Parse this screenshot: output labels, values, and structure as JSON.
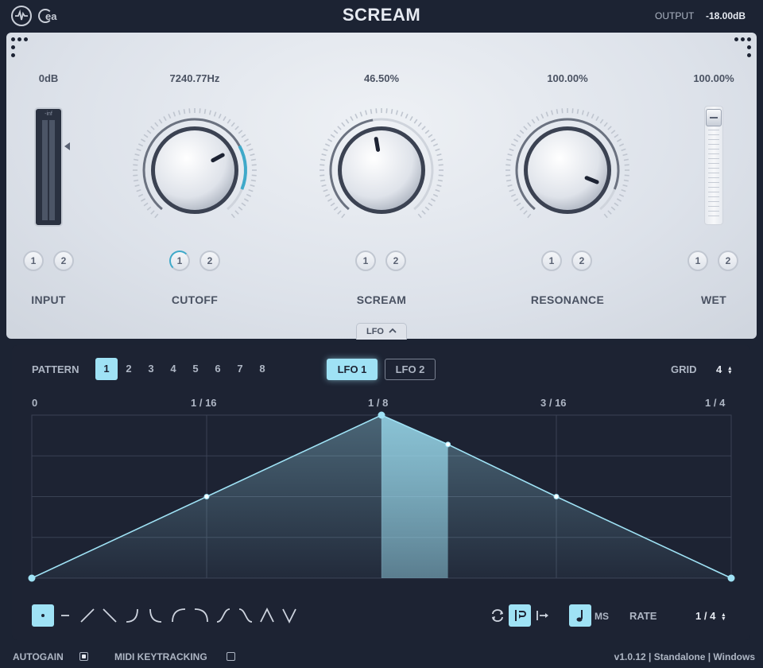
{
  "header": {
    "title": "SCREAM",
    "output_label": "OUTPUT",
    "output_value": "-18.00dB",
    "logo_text": "ea"
  },
  "controls": {
    "input": {
      "label": "INPUT",
      "value": "0dB",
      "meter_label": "-inf",
      "lfo_assign": [
        "1",
        "2"
      ]
    },
    "cutoff": {
      "label": "CUTOFF",
      "value": "7240.77Hz",
      "lfo_assign": [
        "1",
        "2"
      ],
      "active_lfo": "1",
      "knob_fraction": 0.72,
      "mod_range": 0.18
    },
    "scream": {
      "label": "SCREAM",
      "value": "46.50%",
      "lfo_assign": [
        "1",
        "2"
      ],
      "knob_fraction": 0.465
    },
    "resonance": {
      "label": "RESONANCE",
      "value": "100.00%",
      "lfo_assign": [
        "1",
        "2"
      ],
      "knob_fraction": 0.9
    },
    "wet": {
      "label": "WET",
      "value": "100.00%",
      "lfo_assign": [
        "1",
        "2"
      ],
      "fraction": 1.0
    }
  },
  "lfo_tab": {
    "label": "LFO"
  },
  "lfo": {
    "pattern_label": "PATTERN",
    "patterns": [
      "1",
      "2",
      "3",
      "4",
      "5",
      "6",
      "7",
      "8"
    ],
    "active_pattern": "1",
    "lfo_buttons": [
      "LFO 1",
      "LFO 2"
    ],
    "active_lfo": "LFO 1",
    "grid_label": "GRID",
    "grid_value": "4",
    "time_labels": [
      "0",
      "1 / 16",
      "1 / 8",
      "3 / 16",
      "1 / 4"
    ],
    "rate_label": "RATE",
    "rate_value": "1 / 4",
    "ms_label": "MS",
    "shapes": [
      "point",
      "flat",
      "ramp-up",
      "ramp-down",
      "curve-up-1",
      "curve-up-2",
      "curve-down-1",
      "curve-down-2",
      "s-curve-up",
      "s-curve-down",
      "triangle-up",
      "triangle-down"
    ],
    "active_shape": "point",
    "modes": [
      "loop",
      "retrigger",
      "one-shot"
    ],
    "active_mode": "retrigger",
    "playhead_fraction": 0.595,
    "points": [
      {
        "x": 0,
        "y": 0
      },
      {
        "x": 0.25,
        "y": 0.5
      },
      {
        "x": 0.5,
        "y": 1
      },
      {
        "x": 0.595,
        "y": 0.82
      },
      {
        "x": 0.75,
        "y": 0.5
      },
      {
        "x": 1,
        "y": 0
      }
    ],
    "accent_color": "#9fe2f5"
  },
  "footer": {
    "autogain_label": "AUTOGAIN",
    "autogain_checked": true,
    "midi_label": "MIDI KEYTRACKING",
    "midi_checked": false,
    "version": "v1.0.12 | Standalone | Windows"
  }
}
